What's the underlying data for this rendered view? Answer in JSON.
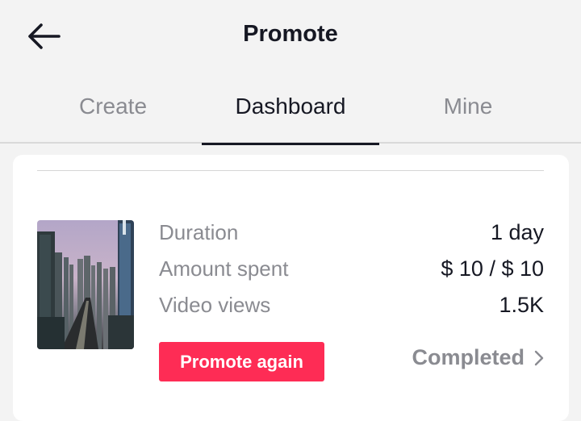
{
  "header": {
    "title": "Promote",
    "back_icon": "arrow-left-icon"
  },
  "tabs": [
    {
      "label": "Create",
      "active": false
    },
    {
      "label": "Dashboard",
      "active": true
    },
    {
      "label": "Mine",
      "active": false
    }
  ],
  "promotion": {
    "thumbnail": "city-skyline-video-thumbnail",
    "rows": [
      {
        "label": "Duration",
        "value": "1 day"
      },
      {
        "label": "Amount spent",
        "value": "$ 10 / $ 10"
      },
      {
        "label": "Video views",
        "value": "1.5K"
      }
    ],
    "promote_again_label": "Promote again",
    "status_label": "Completed",
    "status_icon": "chevron-right-icon"
  },
  "colors": {
    "background": "#f3f3f3",
    "card": "#ffffff",
    "accent": "#fe2c55",
    "text_primary": "#161823",
    "text_secondary": "#8a8b91"
  }
}
